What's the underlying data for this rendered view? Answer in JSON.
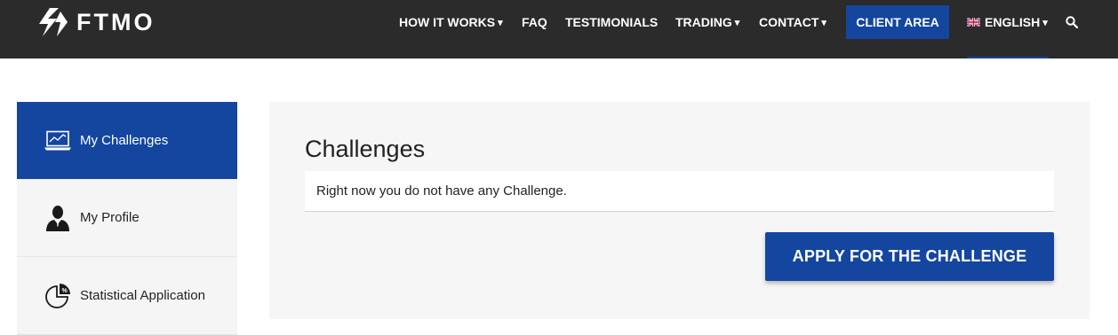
{
  "header": {
    "logo_text": "FTMO",
    "nav": [
      {
        "label": "HOW IT WORKS",
        "caret": "▾"
      },
      {
        "label": "FAQ",
        "caret": ""
      },
      {
        "label": "TESTIMONIALS",
        "caret": ""
      },
      {
        "label": "TRADING",
        "caret": "▾"
      },
      {
        "label": "CONTACT",
        "caret": "▾"
      }
    ],
    "client_area": "CLIENT AREA",
    "language": {
      "label": "ENGLISH",
      "caret": "▾"
    },
    "search_icon": "search-icon"
  },
  "sidebar": {
    "items": [
      {
        "label": "My Challenges",
        "icon": "laptop-chart-icon",
        "active": true
      },
      {
        "label": "My Profile",
        "icon": "user-icon",
        "active": false
      },
      {
        "label": "Statistical Application",
        "icon": "pie-chart-icon",
        "active": false
      }
    ]
  },
  "main": {
    "title": "Challenges",
    "notice": "Right now you do not have any Challenge.",
    "apply_button": "APPLY FOR THE CHALLENGE"
  },
  "colors": {
    "topbar": "#2b2b2b",
    "accent": "#1446a0",
    "panel": "#f6f6f6"
  }
}
